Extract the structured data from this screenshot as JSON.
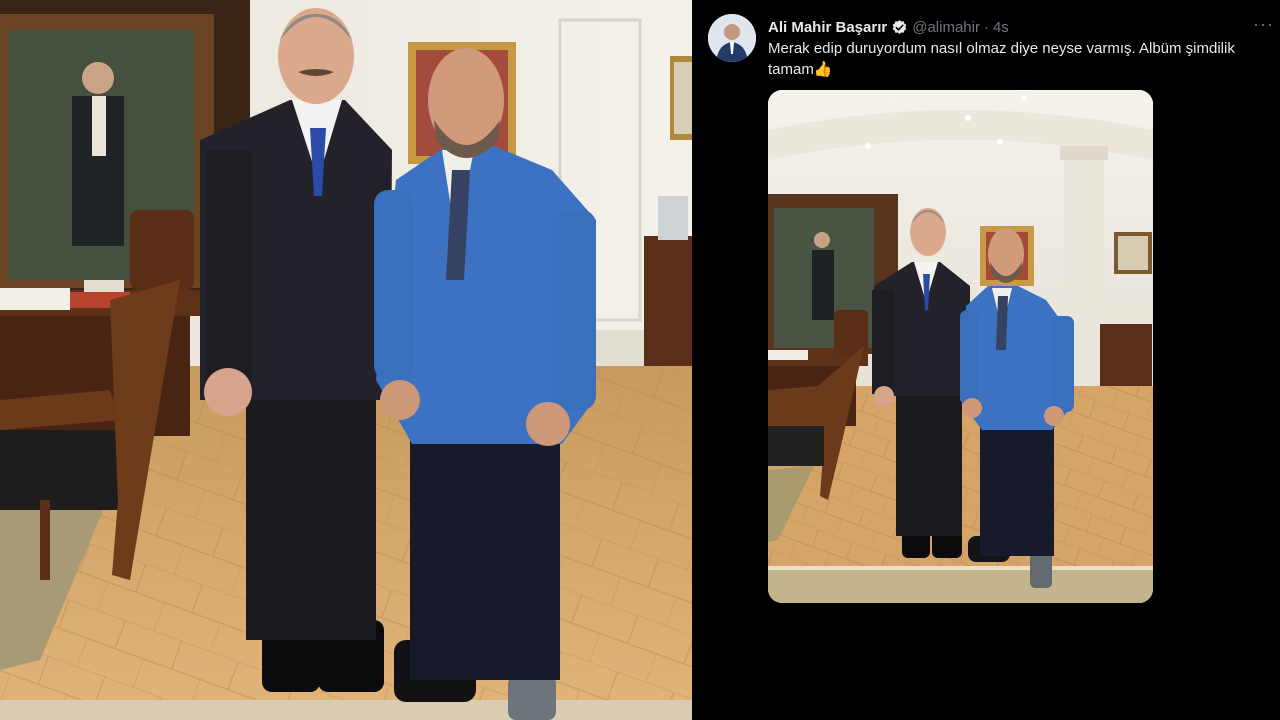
{
  "tweet": {
    "display_name": "Ali Mahir Başarır",
    "handle": "@alimahir",
    "separator": "·",
    "timestamp": "4s",
    "text": "Merak edip duruyordum nasıl olmaz diye neyse varmış. Albüm şimdilik tamam",
    "emoji": "👍",
    "more": "···"
  },
  "colors": {
    "background": "#000000",
    "text_primary": "#e7e9ea",
    "text_secondary": "#71767b",
    "verified": "#1d9bf0",
    "suit_blue": "#3d73c2",
    "suit_dark": "#1c1c22",
    "floor": "#d7a86a"
  },
  "icons": {
    "verified": "verified-badge-icon",
    "more": "more-options-icon"
  }
}
